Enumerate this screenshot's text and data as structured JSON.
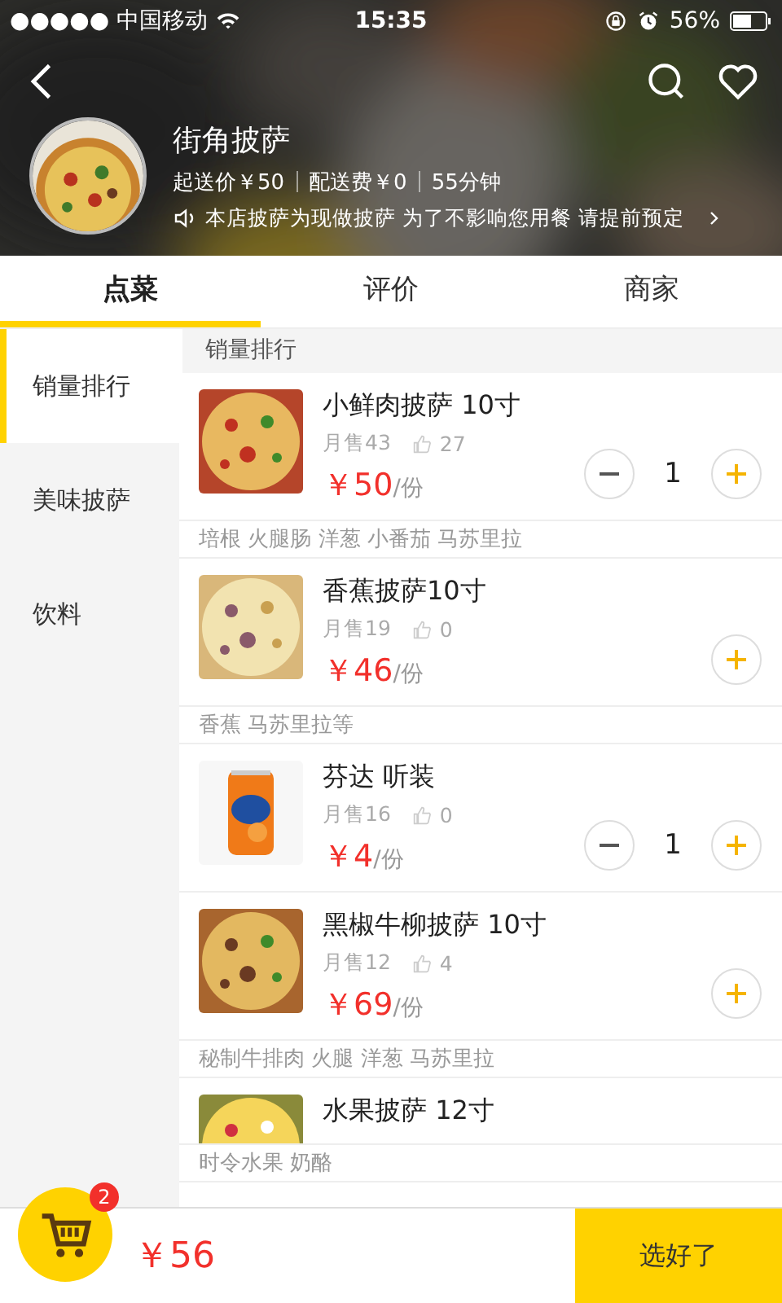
{
  "status_bar": {
    "carrier": "●●●●● 中国移动",
    "time": "15:35",
    "battery": "56%"
  },
  "store": {
    "name": "街角披萨",
    "min_order": "起送价￥50",
    "delivery_fee": "配送费￥0",
    "delivery_time": "55分钟",
    "notice": "本店披萨为现做披萨 为了不影响您用餐 请提前预定"
  },
  "tabs": [
    {
      "label": "点菜",
      "selected": true
    },
    {
      "label": "评价",
      "selected": false
    },
    {
      "label": "商家",
      "selected": false
    }
  ],
  "categories": [
    {
      "label": "销量排行",
      "selected": true
    },
    {
      "label": "美味披萨",
      "selected": false
    },
    {
      "label": "饮料",
      "selected": false
    }
  ],
  "section_title": "销量排行",
  "dishes": [
    {
      "name": "小鲜肉披萨 10寸",
      "sales": "月售43",
      "likes": "27",
      "price": "￥50",
      "unit": "/份",
      "quantity": "1",
      "tags": "培根 火腿肠 洋葱 小番茄 马苏里拉"
    },
    {
      "name": "香蕉披萨10寸",
      "sales": "月售19",
      "likes": "0",
      "price": "￥46",
      "unit": "/份",
      "tags": "香蕉  马苏里拉等"
    },
    {
      "name": "芬达 听装",
      "sales": "月售16",
      "likes": "0",
      "price": "￥4",
      "unit": "/份",
      "quantity": "1"
    },
    {
      "name": "黑椒牛柳披萨 10寸",
      "sales": "月售12",
      "likes": "4",
      "price": "￥69",
      "unit": "/份",
      "tags": "秘制牛排肉 火腿 洋葱 马苏里拉"
    },
    {
      "name": "水果披萨 12寸",
      "tags": "时令水果 奶酪"
    }
  ],
  "cart": {
    "count": "2",
    "total": "￥56",
    "checkout": "选好了"
  }
}
